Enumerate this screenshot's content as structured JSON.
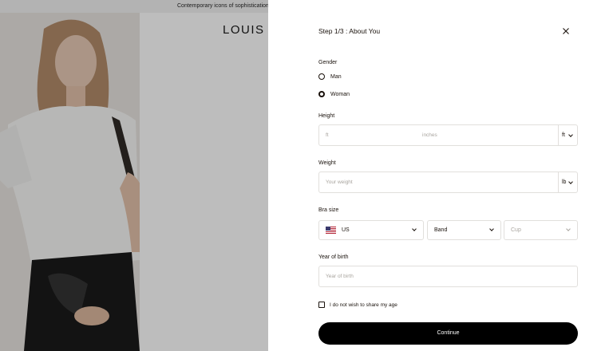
{
  "background": {
    "announcement": "Contemporary icons of sophistication: Sh",
    "brand": "LOUIS V"
  },
  "modal": {
    "step_title": "Step 1/3 : About You",
    "close_icon": "close-icon",
    "gender": {
      "label": "Gender",
      "options": [
        {
          "label": "Man",
          "selected": false
        },
        {
          "label": "Woman",
          "selected": true
        }
      ]
    },
    "height": {
      "label": "Height",
      "placeholder_ft": "ft",
      "placeholder_inches": "inches",
      "unit": "ft"
    },
    "weight": {
      "label": "Weight",
      "placeholder": "Your weight",
      "unit": "lb"
    },
    "bra_size": {
      "label": "Bra size",
      "region": "US",
      "band": "Band",
      "cup": "Cup"
    },
    "year_of_birth": {
      "label": "Year of birth",
      "placeholder": "Year of birth"
    },
    "share_age_checkbox": "I do not wish to share my age",
    "continue_label": "Continue"
  },
  "colors": {
    "primary": "#19110b",
    "button": "#000000",
    "border": "#e1dfdc",
    "placeholder": "#a9a59f"
  }
}
